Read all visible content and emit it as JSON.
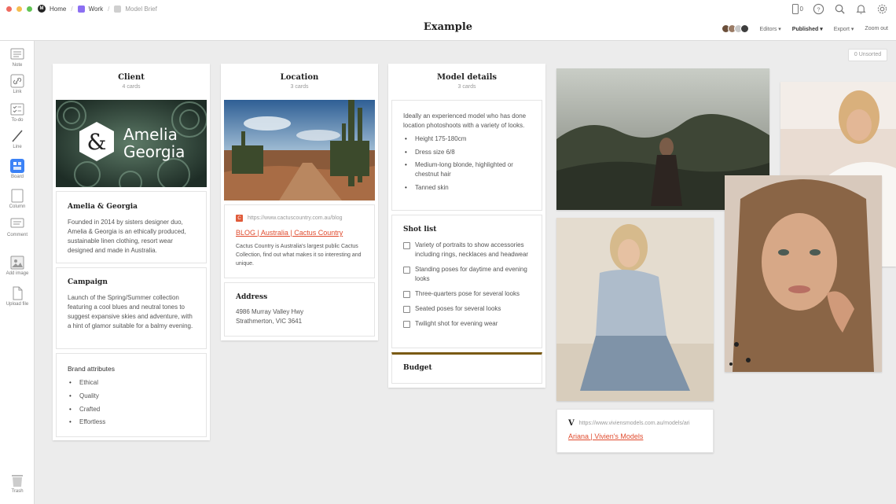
{
  "breadcrumbs": {
    "home": "Home",
    "work": "Work",
    "brief": "Model Brief"
  },
  "board_title": "Example",
  "top_icons": {
    "phone_count": "0"
  },
  "toolbar": {
    "editors": "Editors",
    "published": "Published",
    "export": "Export",
    "zoom_out": "Zoom out"
  },
  "unsorted": "0 Unsorted",
  "sidebar": {
    "note": "Note",
    "link": "Link",
    "todo": "To-do",
    "line": "Line",
    "board": "Board",
    "column": "Column",
    "comment": "Comment",
    "add_image": "Add image",
    "upload_file": "Upload file",
    "trash": "Trash"
  },
  "client": {
    "title": "Client",
    "count": "4 cards",
    "logo_line1": "Amelia",
    "logo_line2": "Georgia",
    "logo_mark": "&",
    "about_title": "Amelia & Georgia",
    "about_text": "Founded in 2014 by sisters designer duo, Amelia & Georgia is an ethically produced, sustainable linen clothing, resort wear designed and made in Australia.",
    "campaign_title": "Campaign",
    "campaign_text": "Launch of the Spring/Summer collection featuring a cool blues and neutral tones to suggest expansive skies and adventure, with a hint of glamor suitable for a balmy evening.",
    "attributes_title": "Brand attributes",
    "attributes": [
      "Ethical",
      "Quality",
      "Crafted",
      "Effortless"
    ]
  },
  "location": {
    "title": "Location",
    "count": "3 cards",
    "link_url": "https://www.cactuscountry.com.au/blog",
    "link_title": "BLOG | Australia | Cactus Country",
    "link_desc": "Cactus Country is Australia's largest public Cactus Collection, find out what makes it so interesting and unique.",
    "address_title": "Address",
    "address_line1": "4986 Murray Valley Hwy",
    "address_line2": "Strathmerton, VIC 3641"
  },
  "model": {
    "title": "Model details",
    "count": "3 cards",
    "intro": "Ideally an experienced model who has done location photoshoots with a variety of looks.",
    "specs": [
      "Height 175-180cm",
      "Dress size 6/8",
      "Medium-long blonde, highlighted or chestnut hair",
      "Tanned skin"
    ],
    "shotlist_title": "Shot list",
    "shots": [
      "Variety of portraits to show accessories including rings, necklaces and headwear",
      "Standing poses for daytime and evening looks",
      "Three-quarters pose for several looks",
      "Seated poses for several looks",
      "Twilight shot for evening wear"
    ],
    "budget_title": "Budget"
  },
  "agency_link": {
    "icon_letter": "V",
    "url": "https://www.viviensmodels.com.au/models/ari",
    "title": "Ariana | Vivien's Models"
  },
  "colors": {
    "accent_red": "#e04b2e",
    "budget_bar": "#7a5a14",
    "board_icon": "#3b82f6"
  }
}
